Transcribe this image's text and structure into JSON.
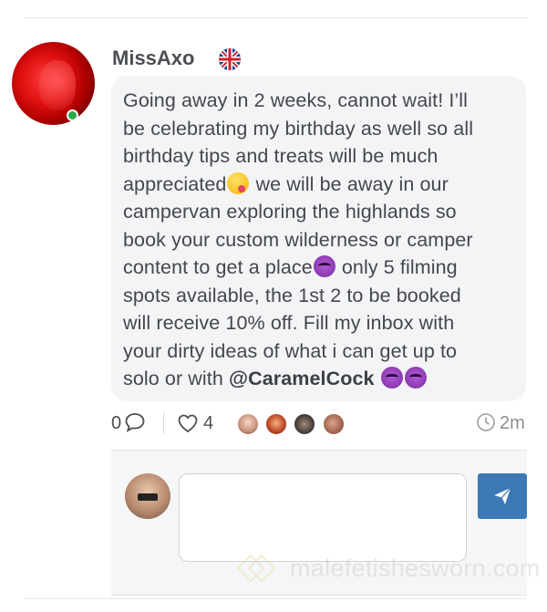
{
  "post": {
    "username": "MissAxo",
    "country_flag": "uk-flag-icon",
    "online_status_color": "#2aa84a",
    "message_lines": [
      "Going away in 2 weeks, cannot wait! I’ll",
      "be celebrating my birthday as well so all",
      "birthday tips and treats will be much",
      "appreciated",
      " we will be away in our",
      "campervan exploring the highlands so",
      "book your custom wilderness or camper",
      "content to get a place",
      " only 5 filming",
      "spots available, the 1st 2 to be booked",
      "will receive 10% off. Fill my inbox with",
      "your dirty ideas of what i can get up to",
      "solo or with "
    ],
    "mention": "@CaramelCock",
    "emojis": [
      "winking-tongue-emoji",
      "smiling-devil-emoji"
    ]
  },
  "meta": {
    "comment_count": "0",
    "like_count": "4",
    "time_ago": "2m",
    "liker_avatars": 4
  },
  "composer": {
    "placeholder": "",
    "send_icon": "paper-plane-icon",
    "send_color": "#3c79b6"
  },
  "watermark": {
    "text": "malefetishesworn.com"
  }
}
